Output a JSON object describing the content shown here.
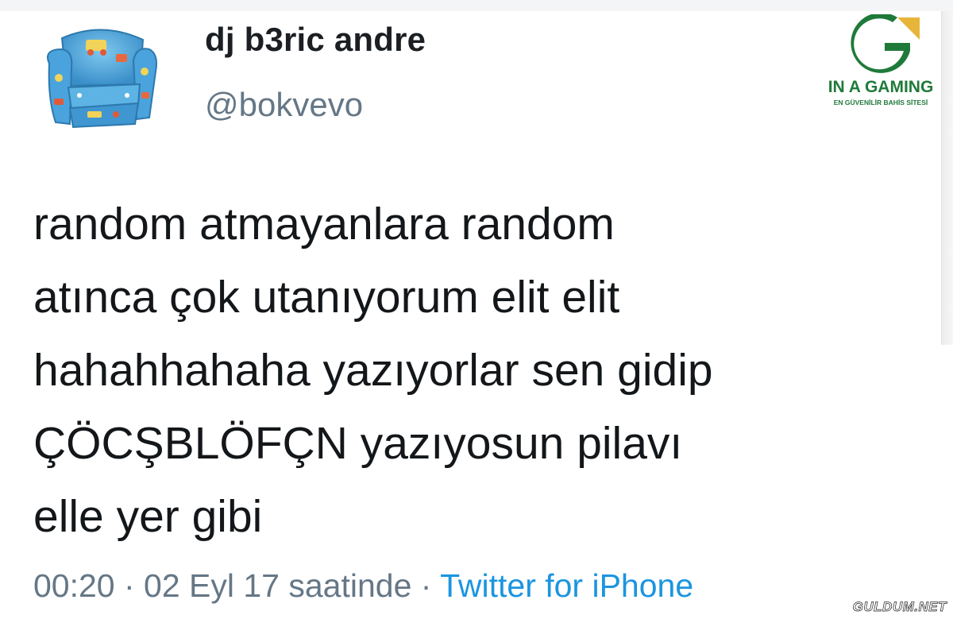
{
  "tweet": {
    "display_name": "dj b3ric andre",
    "handle": "@bokvevo",
    "avatar_icon": "toy-armchair-avatar",
    "lines": [
      "random atmayanlara random",
      "atınca çok utanıyorum elit elit",
      "hahahhahaha yazıyorlar sen gidip",
      "ÇÖCŞBLÖFÇN yazıyosun pilavı",
      "elle yer gibi"
    ],
    "timestamp": "00:20 · 02 Eyl 17 saatinde",
    "separator": "·",
    "source": "Twitter for iPhone"
  },
  "watermark": {
    "title": "IN A GAMING",
    "subtitle": "EN GÜVENİLİR BAHİS SİTESİ",
    "logo_icon": "ina-gaming-logo-icon",
    "colors": {
      "green": "#1f7a3a",
      "gold": "#e7b53a"
    }
  },
  "site_mark": {
    "text": "GULDUM.NET"
  },
  "colors": {
    "text": "#14171a",
    "muted": "#657786",
    "link": "#1b95e0"
  }
}
